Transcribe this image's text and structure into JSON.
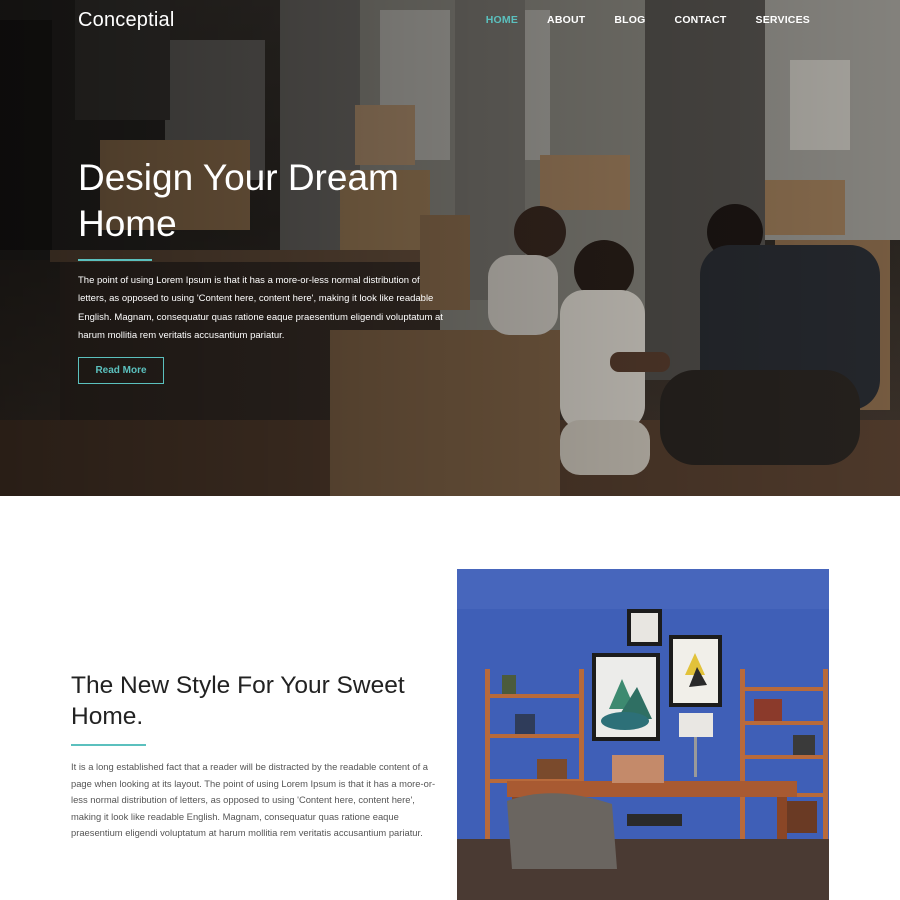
{
  "brand": {
    "name": "Conceptial"
  },
  "nav": {
    "items": [
      {
        "label": "HOME",
        "active": true
      },
      {
        "label": "ABOUT",
        "active": false
      },
      {
        "label": "BLOG",
        "active": false
      },
      {
        "label": "CONTACT",
        "active": false
      },
      {
        "label": "SERVICES",
        "active": false
      }
    ]
  },
  "hero": {
    "title_line1": "Design Your Dream",
    "title_line2": "Home",
    "text": "The point of using Lorem Ipsum is that it has a more-or-less normal distribution of letters, as opposed to using 'Content here, content here', making it look like readable English. Magnam, consequatur quas ratione eaque praesentium eligendi voluptatum at harum mollitia rem veritatis accusantium pariatur.",
    "button_label": "Read More"
  },
  "about": {
    "title": "The New Style For Your Sweet Home.",
    "body": "It is a long established fact that a reader will be distracted by the readable content of a page when looking at its layout. The point of using Lorem Ipsum is that it has a more-or-less normal distribution of letters, as opposed to using 'Content here, content here', making it look like readable English. Magnam, consequatur quas ratione eaque praesentium eligendi voluptatum at harum mollitia rem veritatis accusantium pariatur."
  },
  "colors": {
    "accent": "#5bc0be",
    "room_wall": "#3f5fb7",
    "hero_dark": "#2e2924"
  }
}
